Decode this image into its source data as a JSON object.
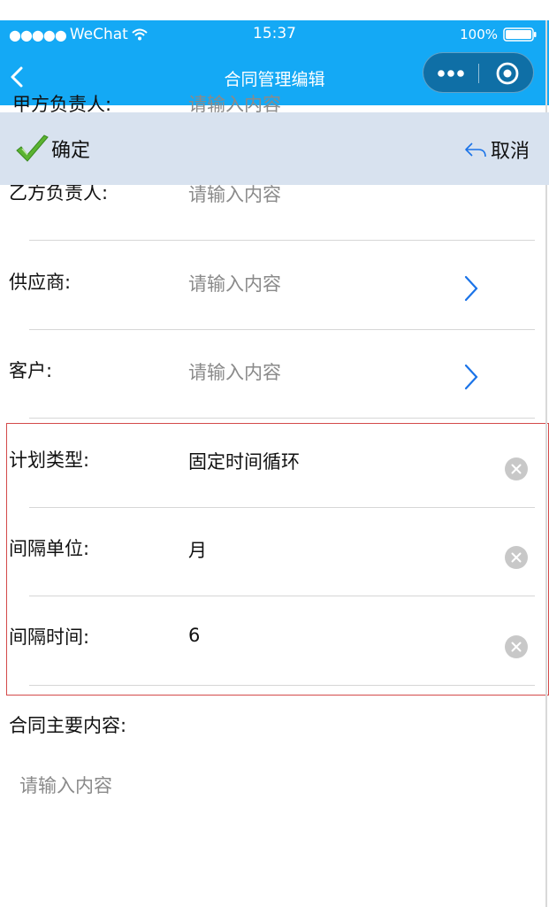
{
  "status_bar": {
    "carrier": "WeChat",
    "signal": "●●●●●",
    "time": "15:37",
    "battery": "100%"
  },
  "nav": {
    "title": "合同管理编辑",
    "icons": [
      "chevron-left-icon",
      "more-icon",
      "close-capsule-icon"
    ]
  },
  "actions": {
    "confirm_label": "确定",
    "cancel_label": "取消",
    "icons": [
      "checkmark-icon",
      "undo-icon"
    ]
  },
  "form": {
    "clipped_row": {
      "label": "甲方负责人:",
      "placeholder": "请输入内容"
    },
    "rows": [
      {
        "label": "乙方负责人:",
        "value": "请输入内容"
      },
      {
        "label": "供应商:",
        "value": "请输入内容"
      },
      {
        "label": "客户:",
        "value": "请输入内容"
      },
      {
        "label": "计划类型:",
        "value": "固定时间循环"
      },
      {
        "label": "间隔单位:",
        "value": "月"
      },
      {
        "label": "间隔时间:",
        "value": "6"
      }
    ],
    "content": {
      "label": "合同主要内容:",
      "placeholder": "请输入内容"
    }
  },
  "colors": {
    "header": "#14a9f5",
    "action_bar": "#d8e2ef",
    "highlight": "#d44a4a",
    "chevron": "#1a73e8"
  }
}
